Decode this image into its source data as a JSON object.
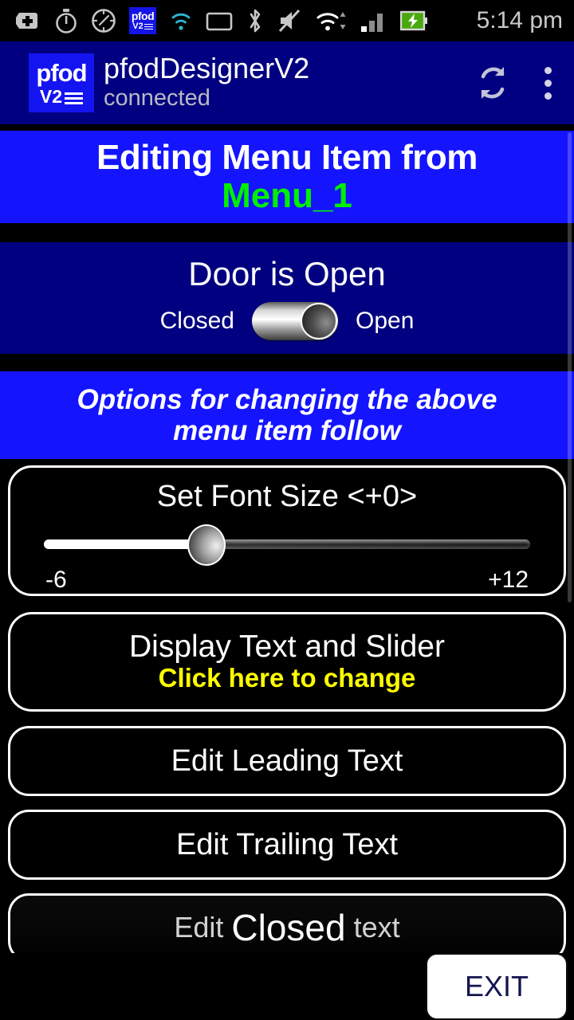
{
  "status_bar": {
    "time": "5:14 pm",
    "icons": [
      "sd-card-plus-icon",
      "stopwatch-icon",
      "clock-icon",
      "pfod-notification-icon",
      "wifi-direct-icon",
      "folder-icon",
      "bluetooth-icon",
      "mute-icon",
      "wifi-icon",
      "signal-bars-icon",
      "battery-charging-icon"
    ],
    "pfod_badge": {
      "top": "pfod",
      "bottom": "V2"
    }
  },
  "app_bar": {
    "logo": {
      "top": "pfod",
      "bottom": "V2"
    },
    "title": "pfodDesignerV2",
    "subtitle": "connected",
    "refresh_label": "refresh",
    "overflow_label": "more options"
  },
  "menu_banner": {
    "line1": "Editing Menu Item from",
    "line2": "Menu_1",
    "line2_color": "#00f000",
    "background": "#1414ff"
  },
  "door_panel": {
    "title": "Door is Open",
    "off_label": "Closed",
    "on_label": "Open",
    "toggle_state": "on",
    "background": "#000080"
  },
  "options_banner": {
    "line1": "Options for changing the above",
    "line2": "menu item follow",
    "background": "#1414ff"
  },
  "font_card": {
    "title": "Set Font Size <+0>",
    "min_label": "-6",
    "max_label": "+12",
    "value": 0,
    "min": -6,
    "max": 12,
    "thumb_percent": 33.5
  },
  "display_card": {
    "line1": "Display Text and Slider",
    "line2": "Click here to change",
    "line2_color": "#ffff00"
  },
  "buttons": {
    "edit_leading": "Edit Leading Text",
    "edit_trailing": "Edit Trailing Text",
    "edit_closed_prefix": "Edit",
    "edit_closed_emphasis": "Closed",
    "edit_closed_suffix": "text"
  },
  "exit": {
    "label": "EXIT",
    "text_color": "#141452"
  }
}
